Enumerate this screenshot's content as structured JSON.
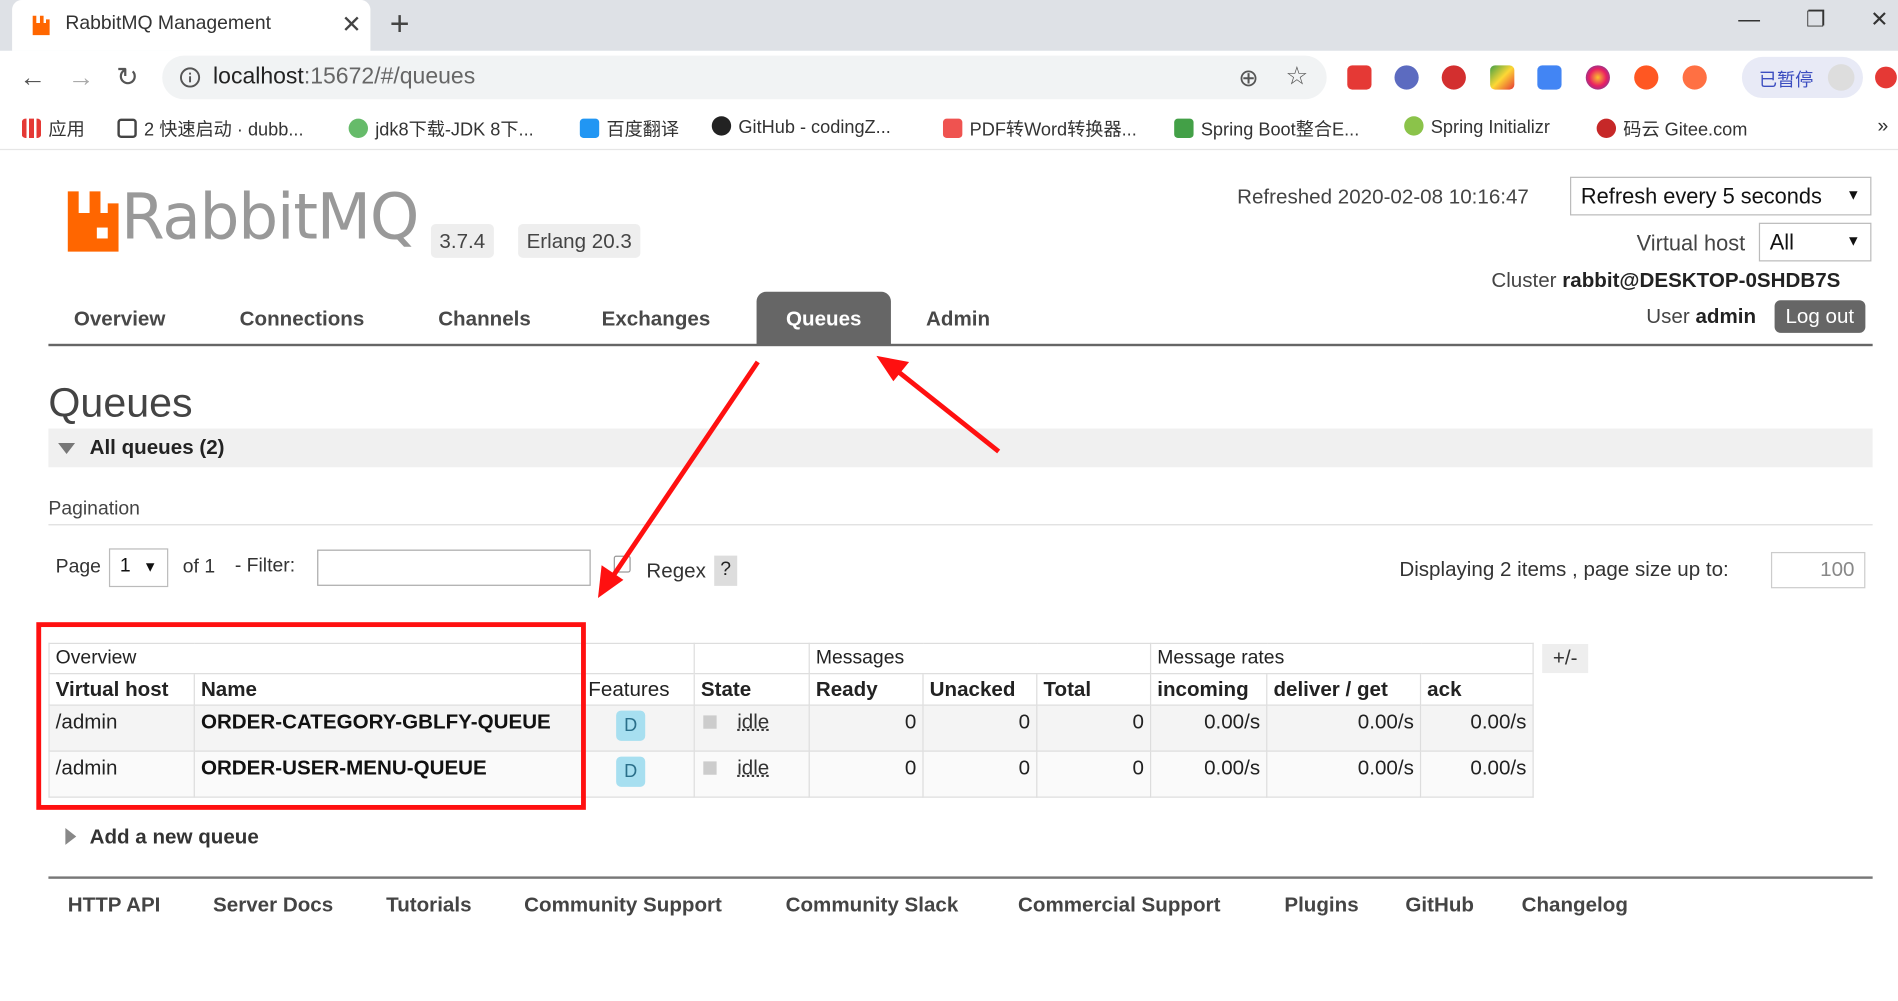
{
  "browser": {
    "tab_title": "RabbitMQ Management",
    "url_host": "localhost",
    "url_rest": ":15672/#/queues",
    "paused_label": "已暂停",
    "bookmarks": [
      "应用",
      "2 快速启动 · dubb...",
      "jdk8下载-JDK 8下...",
      "百度翻译",
      "GitHub - codingZ...",
      "PDF转Word转换器...",
      "Spring Boot整合E...",
      "Spring Initializr",
      "码云 Gitee.com"
    ]
  },
  "header": {
    "logo_text": "RabbitMQ",
    "version": "3.7.4",
    "erlang": "Erlang 20.3",
    "refreshed": "Refreshed 2020-02-08 10:16:47",
    "refresh_select": "Refresh every 5 seconds",
    "vhost_label": "Virtual host",
    "vhost_select": "All",
    "cluster_label": "Cluster",
    "cluster_name": "rabbit@DESKTOP-0SHDB7S",
    "user_label": "User",
    "user_name": "admin",
    "logout": "Log out"
  },
  "nav": {
    "tabs": [
      "Overview",
      "Connections",
      "Channels",
      "Exchanges",
      "Queues",
      "Admin"
    ],
    "active": "Queues"
  },
  "page": {
    "title": "Queues",
    "section": "All queues (2)",
    "pagination_label": "Pagination",
    "page_label": "Page",
    "page_value": "1",
    "of_label": "of 1",
    "filter_label": "- Filter:",
    "regex_label": "Regex",
    "help": "?",
    "displaying": "Displaying 2 items , page size up to:",
    "page_size": "100",
    "plus_minus": "+/-",
    "add_queue": "Add a new queue"
  },
  "table": {
    "groups": [
      "Overview",
      "Messages",
      "Message rates"
    ],
    "columns": [
      "Virtual host",
      "Name",
      "Features",
      "State",
      "Ready",
      "Unacked",
      "Total",
      "incoming",
      "deliver / get",
      "ack"
    ],
    "rows": [
      {
        "vhost": "/admin",
        "name": "ORDER-CATEGORY-GBLFY-QUEUE",
        "feature": "D",
        "state": "idle",
        "ready": "0",
        "unacked": "0",
        "total": "0",
        "incoming": "0.00/s",
        "deliver": "0.00/s",
        "ack": "0.00/s"
      },
      {
        "vhost": "/admin",
        "name": "ORDER-USER-MENU-QUEUE",
        "feature": "D",
        "state": "idle",
        "ready": "0",
        "unacked": "0",
        "total": "0",
        "incoming": "0.00/s",
        "deliver": "0.00/s",
        "ack": "0.00/s"
      }
    ]
  },
  "footer": [
    "HTTP API",
    "Server Docs",
    "Tutorials",
    "Community Support",
    "Community Slack",
    "Commercial Support",
    "Plugins",
    "GitHub",
    "Changelog"
  ],
  "colors": {
    "accent": "#ff6600",
    "annotation": "#ff1010",
    "nav_active": "#666666"
  }
}
